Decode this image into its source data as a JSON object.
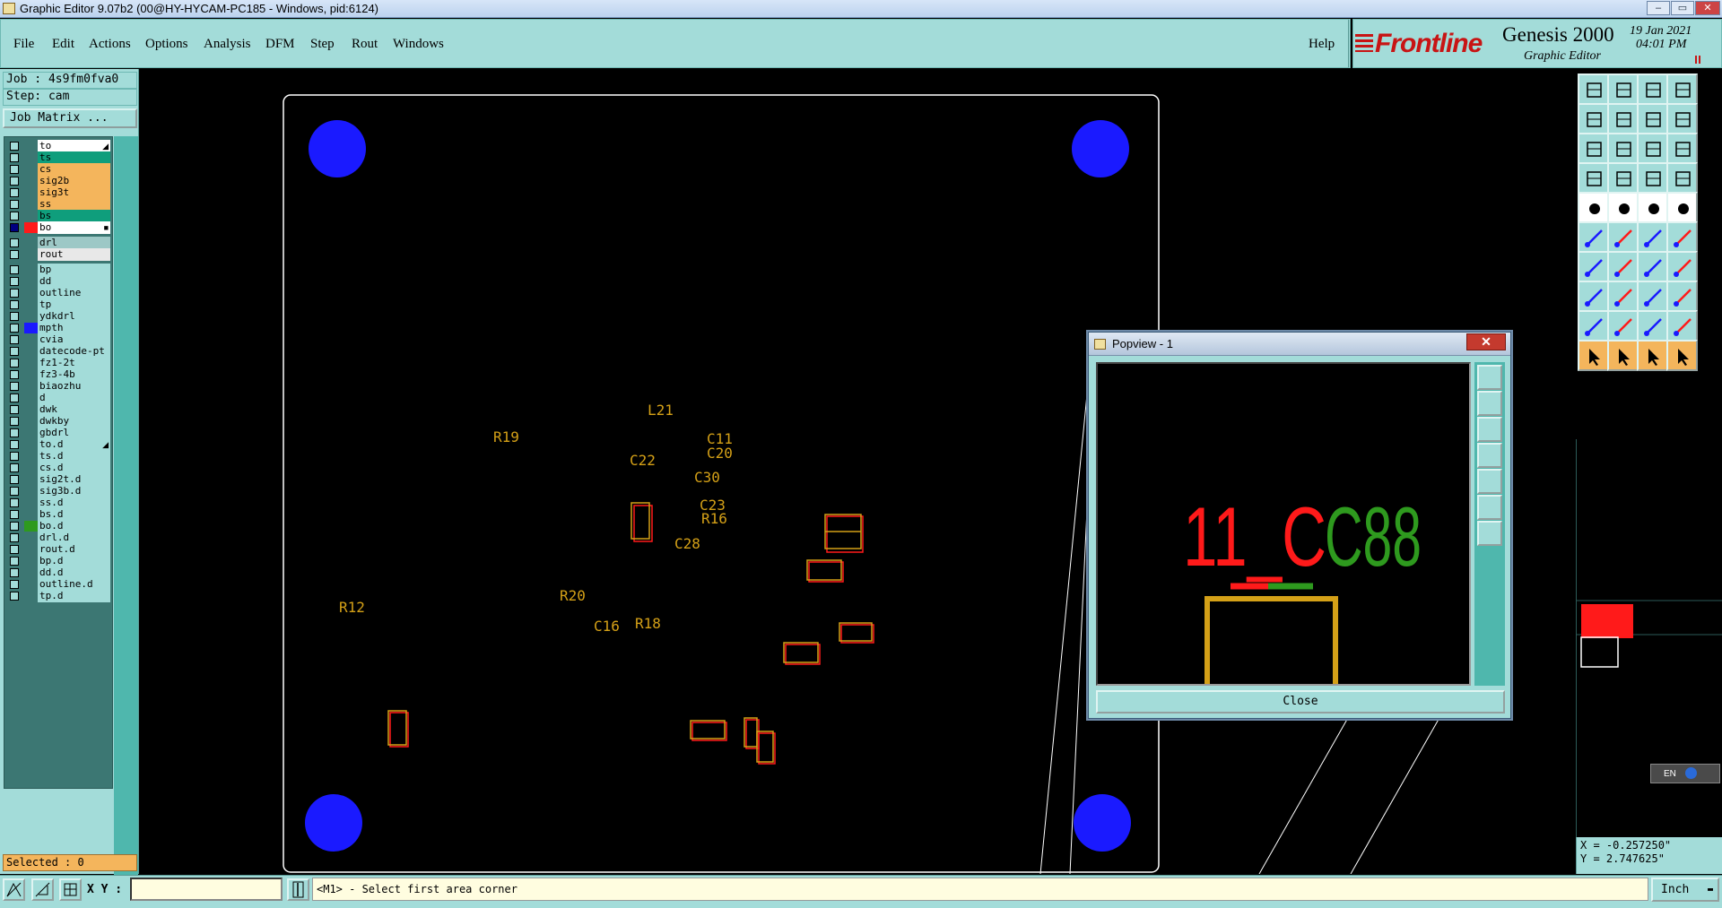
{
  "window": {
    "title": "Graphic Editor 9.07b2 (00@HY-HYCAM-PC185 - Windows, pid:6124)",
    "min": "–",
    "max": "▭",
    "close": "✕"
  },
  "menu": [
    "File",
    "Edit",
    "Actions",
    "Options",
    "Analysis",
    "DFM",
    "Step",
    "Rout",
    "Windows"
  ],
  "help": "Help",
  "logo": {
    "brand": "Frontline",
    "product": "Genesis 2000",
    "subtitle": "Graphic Editor",
    "date": "19 Jan 2021",
    "time": "04:01 PM"
  },
  "job": {
    "job_line": "Job : 4s9fm0fva0",
    "step_line": "Step: cam",
    "matrix_button": "Job Matrix ..."
  },
  "layers": [
    {
      "name": "to",
      "color": "#ffffff",
      "mark": "◢",
      "on": false,
      "swatch": ""
    },
    {
      "name": "ts",
      "color": "#0f9e7c",
      "mark": "",
      "on": false,
      "swatch": ""
    },
    {
      "name": "cs",
      "color": "#f4b55c",
      "mark": "",
      "on": false,
      "swatch": ""
    },
    {
      "name": "sig2b",
      "color": "#f4b55c",
      "mark": "",
      "on": false,
      "swatch": ""
    },
    {
      "name": "sig3t",
      "color": "#f4b55c",
      "mark": "",
      "on": false,
      "swatch": ""
    },
    {
      "name": "ss",
      "color": "#f4b55c",
      "mark": "",
      "on": false,
      "swatch": ""
    },
    {
      "name": "bs",
      "color": "#0f9e7c",
      "mark": "",
      "on": false,
      "swatch": ""
    },
    {
      "name": "bo",
      "color": "#ffffff",
      "mark": "■",
      "on": true,
      "swatch": "#ff1a1a"
    },
    {
      "name": "drl",
      "color": "#9dc8c6",
      "mark": "",
      "on": false,
      "swatch": "",
      "gap": true
    },
    {
      "name": "rout",
      "color": "#e8e8e8",
      "mark": "",
      "on": false,
      "swatch": ""
    },
    {
      "name": "bp",
      "color": "#a3dcd9",
      "mark": "",
      "on": false,
      "swatch": "",
      "gap": true
    },
    {
      "name": "dd",
      "color": "#a3dcd9",
      "mark": "",
      "on": false,
      "swatch": ""
    },
    {
      "name": "outline",
      "color": "#a3dcd9",
      "mark": "",
      "on": false,
      "swatch": ""
    },
    {
      "name": "tp",
      "color": "#a3dcd9",
      "mark": "",
      "on": false,
      "swatch": ""
    },
    {
      "name": "ydkdrl",
      "color": "#a3dcd9",
      "mark": "",
      "on": false,
      "swatch": ""
    },
    {
      "name": "mpth",
      "color": "#a3dcd9",
      "mark": "",
      "on": false,
      "swatch": "#1a1aff"
    },
    {
      "name": "cvia",
      "color": "#a3dcd9",
      "mark": "",
      "on": false,
      "swatch": ""
    },
    {
      "name": "datecode-pt",
      "color": "#a3dcd9",
      "mark": "",
      "on": false,
      "swatch": ""
    },
    {
      "name": "fz1-2t",
      "color": "#a3dcd9",
      "mark": "",
      "on": false,
      "swatch": ""
    },
    {
      "name": "fz3-4b",
      "color": "#a3dcd9",
      "mark": "",
      "on": false,
      "swatch": ""
    },
    {
      "name": "biaozhu",
      "color": "#a3dcd9",
      "mark": "",
      "on": false,
      "swatch": ""
    },
    {
      "name": "d",
      "color": "#a3dcd9",
      "mark": "",
      "on": false,
      "swatch": ""
    },
    {
      "name": "dwk",
      "color": "#a3dcd9",
      "mark": "",
      "on": false,
      "swatch": ""
    },
    {
      "name": "dwkby",
      "color": "#a3dcd9",
      "mark": "",
      "on": false,
      "swatch": ""
    },
    {
      "name": "gbdrl",
      "color": "#a3dcd9",
      "mark": "",
      "on": false,
      "swatch": ""
    },
    {
      "name": "to.d",
      "color": "#a3dcd9",
      "mark": "◢",
      "on": false,
      "swatch": ""
    },
    {
      "name": "ts.d",
      "color": "#a3dcd9",
      "mark": "",
      "on": false,
      "swatch": ""
    },
    {
      "name": "cs.d",
      "color": "#a3dcd9",
      "mark": "",
      "on": false,
      "swatch": ""
    },
    {
      "name": "sig2t.d",
      "color": "#a3dcd9",
      "mark": "",
      "on": false,
      "swatch": ""
    },
    {
      "name": "sig3b.d",
      "color": "#a3dcd9",
      "mark": "",
      "on": false,
      "swatch": ""
    },
    {
      "name": "ss.d",
      "color": "#a3dcd9",
      "mark": "",
      "on": false,
      "swatch": ""
    },
    {
      "name": "bs.d",
      "color": "#a3dcd9",
      "mark": "",
      "on": false,
      "swatch": ""
    },
    {
      "name": "bo.d",
      "color": "#a3dcd9",
      "mark": "",
      "on": false,
      "swatch": "#2e9a1e"
    },
    {
      "name": "drl.d",
      "color": "#a3dcd9",
      "mark": "",
      "on": false,
      "swatch": ""
    },
    {
      "name": "rout.d",
      "color": "#a3dcd9",
      "mark": "",
      "on": false,
      "swatch": ""
    },
    {
      "name": "bp.d",
      "color": "#a3dcd9",
      "mark": "",
      "on": false,
      "swatch": ""
    },
    {
      "name": "dd.d",
      "color": "#a3dcd9",
      "mark": "",
      "on": false,
      "swatch": ""
    },
    {
      "name": "outline.d",
      "color": "#a3dcd9",
      "mark": "",
      "on": false,
      "swatch": ""
    },
    {
      "name": "tp.d",
      "color": "#a3dcd9",
      "mark": "",
      "on": false,
      "swatch": ""
    }
  ],
  "selected": "Selected : 0",
  "board": {
    "labels": [
      "L21",
      "R19",
      "C11",
      "C20",
      "C22",
      "C30",
      "C23",
      "R16",
      "C28",
      "R12",
      "R20",
      "C16",
      "R18"
    ]
  },
  "popview": {
    "title": "Popview - 1",
    "close_label": "Close",
    "zoom_text_red": "11_C",
    "zoom_text_green": "C88",
    "close_x": "✕"
  },
  "coords": {
    "x": "X = -0.257250\"",
    "y": "Y = 2.747625\""
  },
  "lang": "EN",
  "status": {
    "xy_label": "X Y :",
    "message": "<M1> - Select first area corner",
    "units": "Inch"
  },
  "colors": {
    "panel": "#a3dcd9",
    "pad": "#1a1aff",
    "comp": "#d4a017",
    "red": "#ff1a1a",
    "green": "#2e9a1e"
  }
}
